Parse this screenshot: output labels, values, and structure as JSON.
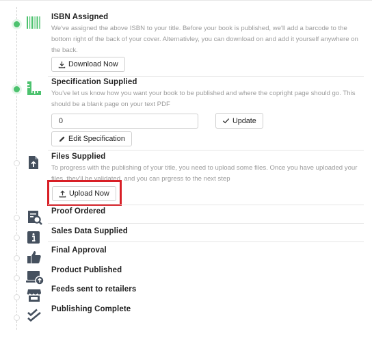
{
  "steps": [
    {
      "title": "ISBN Assigned",
      "description": "We've assigned the above ISBN to your title. Before your book is published, we'll add a barcode to the bottom right of the back of your cover. Alternativley, you can download on and add it yourself anywhere on the back.",
      "button_label": "Download Now",
      "icon": "barcode-icon",
      "status": "complete"
    },
    {
      "title": "Specification Supplied",
      "description": "You've let us know how you want your book to be published and where the copright page should go. This should be a blank page on your text PDF",
      "input_value": "0",
      "update_label": "Update",
      "edit_label": "Edit Specification",
      "icon": "ruler-icon",
      "status": "complete"
    },
    {
      "title": "Files Supplied",
      "description": "To progress with the publishing of your title, you need to upload some files. Once you have uploaded your files, they'll be validated, and you can prgress to the next step",
      "button_label": "Upload Now",
      "icon": "file-upload-icon",
      "status": "pending"
    },
    {
      "title": "Proof Ordered",
      "icon": "proof-search-icon",
      "status": "pending"
    },
    {
      "title": "Sales Data Supplied",
      "icon": "info-icon",
      "status": "pending"
    },
    {
      "title": "Final Approval",
      "icon": "thumbs-up-icon",
      "status": "pending"
    },
    {
      "title": "Product Published",
      "icon": "laptop-upload-icon",
      "status": "pending"
    },
    {
      "title": "Feeds sent to retailers",
      "icon": "store-icon",
      "status": "pending"
    },
    {
      "title": "Publishing Complete",
      "icon": "double-check-icon",
      "status": "pending"
    }
  ],
  "colors": {
    "accent_green": "#4cc26e",
    "icon_dark": "#45505e",
    "highlight_red": "#d81f26"
  }
}
